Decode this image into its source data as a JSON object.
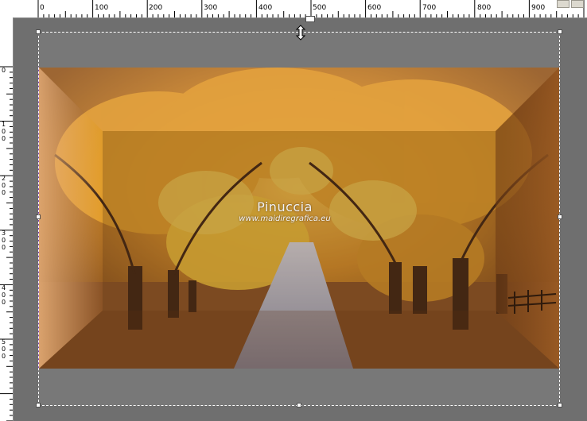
{
  "ruler_top": {
    "labels": [
      "0",
      "100",
      "200",
      "300",
      "400",
      "500",
      "600",
      "700",
      "800",
      "900"
    ]
  },
  "ruler_left": {
    "labels": [
      {
        "digits": "0"
      },
      {
        "digits": "100"
      },
      {
        "digits": "200"
      },
      {
        "digits": "300"
      },
      {
        "digits": "400"
      },
      {
        "digits": "500"
      }
    ]
  },
  "watermark": {
    "name": "Pinuccia",
    "url": "www.maidiregrafica.eu"
  },
  "cursor": {
    "icon": "move-vertical-cursor-icon"
  },
  "colors": {
    "canvas_bg": "#787878",
    "workspace_bg": "#6f6f6f",
    "ruler_bg": "#ffffff",
    "selection": "#ffffff"
  }
}
